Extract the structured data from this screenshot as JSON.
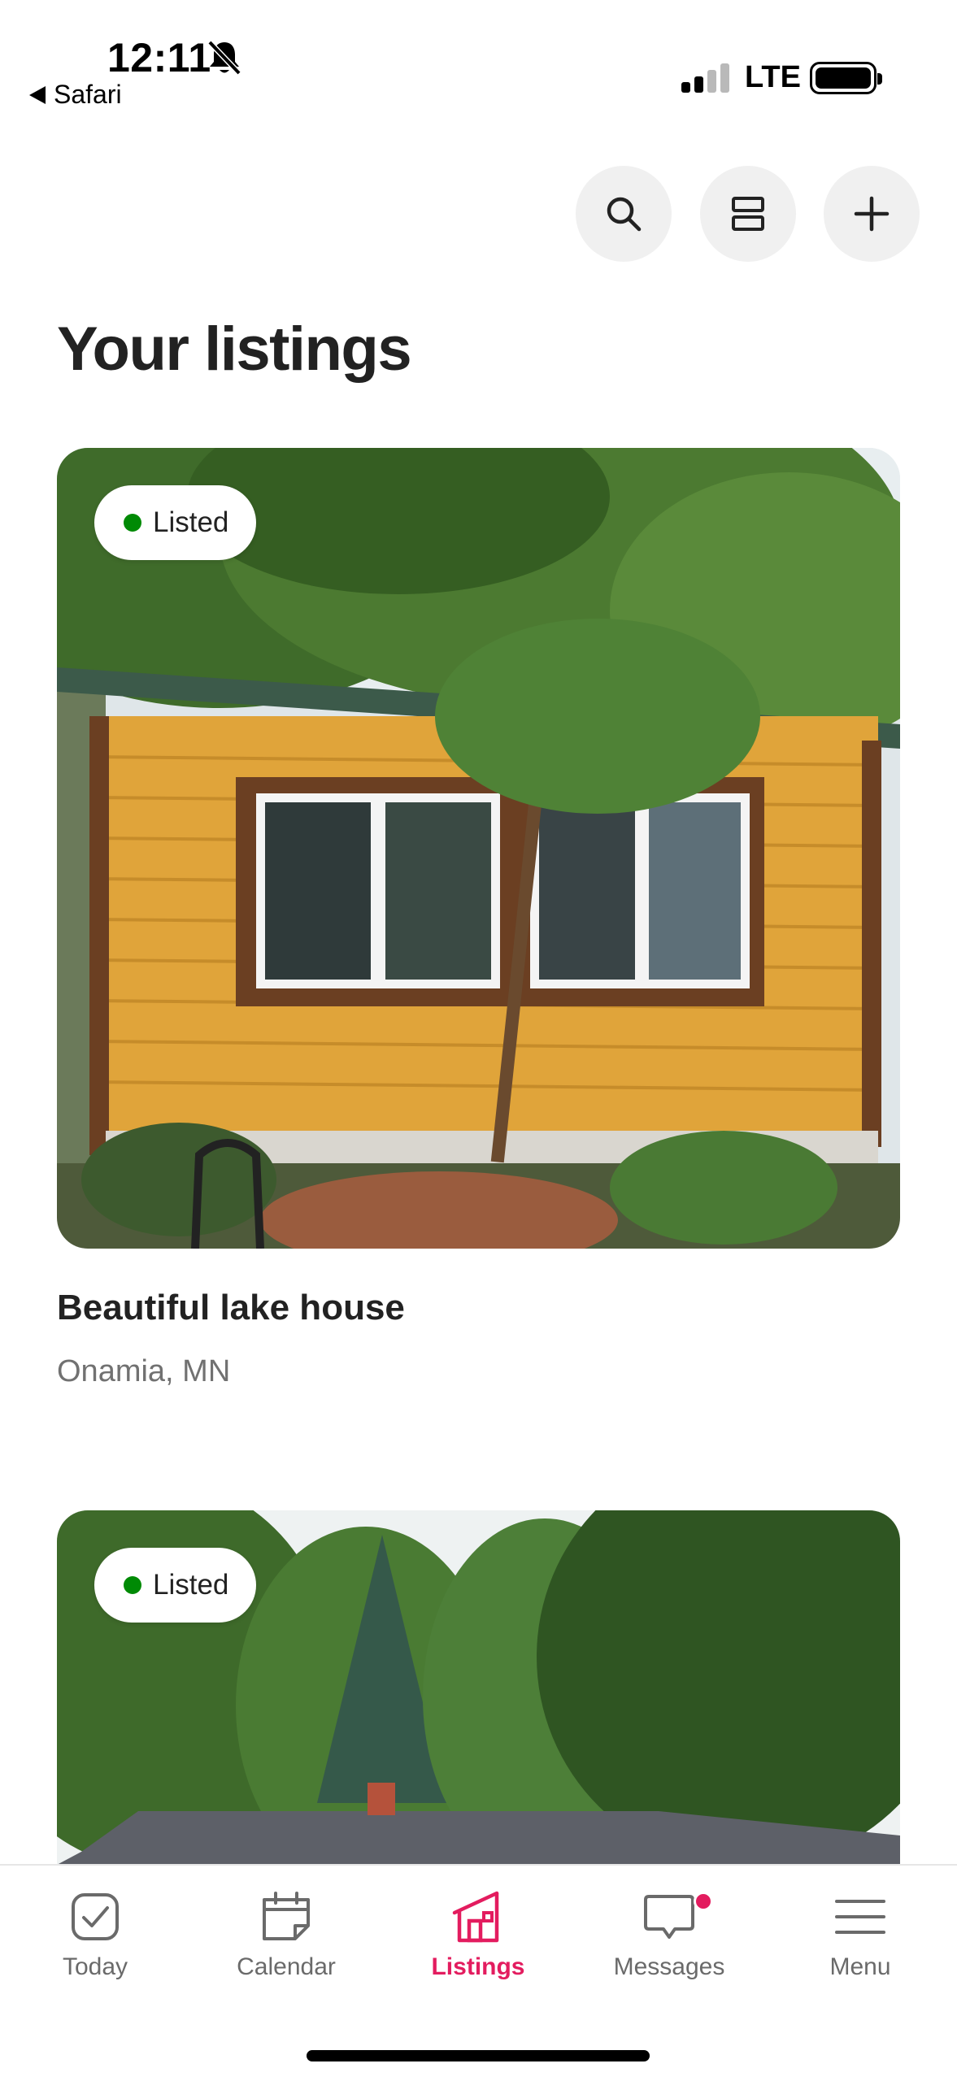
{
  "status_bar": {
    "time": "12:11",
    "back_app": "Safari",
    "network": "LTE"
  },
  "toolbar": {
    "search_icon": "search-icon",
    "layout_icon": "layout-toggle-icon",
    "add_icon": "plus-icon"
  },
  "page": {
    "title": "Your listings"
  },
  "listings": [
    {
      "status": "Listed",
      "title": "Beautiful lake house",
      "location": "Onamia, MN"
    },
    {
      "status": "Listed"
    }
  ],
  "tabs": [
    {
      "label": "Today",
      "icon": "check-square-icon"
    },
    {
      "label": "Calendar",
      "icon": "calendar-icon"
    },
    {
      "label": "Listings",
      "icon": "house-icon",
      "active": true
    },
    {
      "label": "Messages",
      "icon": "chat-bubble-icon",
      "unread": true
    },
    {
      "label": "Menu",
      "icon": "hamburger-menu-icon"
    }
  ],
  "colors": {
    "accent": "#e31c5f",
    "listed_status": "#008a05",
    "muted_text": "#717171"
  }
}
